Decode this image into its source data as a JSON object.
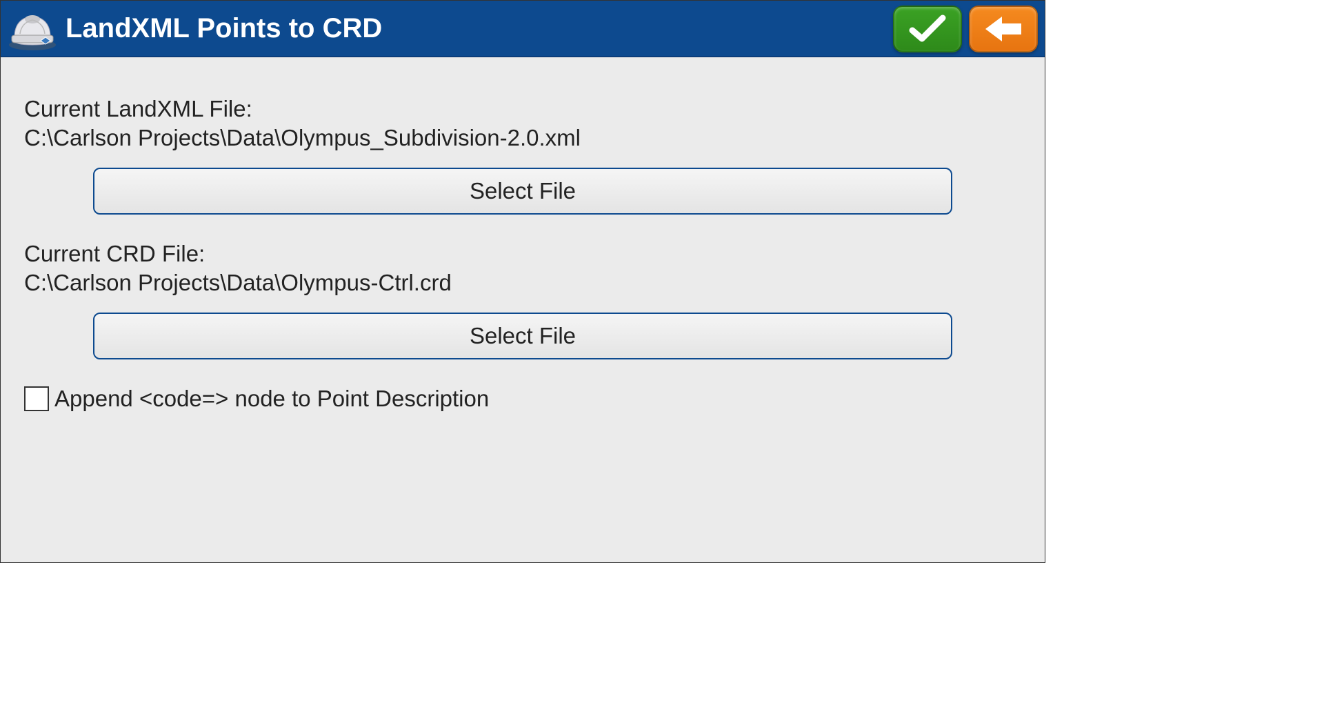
{
  "header": {
    "title": "LandXML Points to CRD"
  },
  "landxml": {
    "label": "Current LandXML File:",
    "path": "C:\\Carlson Projects\\Data\\Olympus_Subdivision-2.0.xml",
    "select_label": "Select File"
  },
  "crd": {
    "label": "Current CRD File:",
    "path": "C:\\Carlson Projects\\Data\\Olympus-Ctrl.crd",
    "select_label": "Select File"
  },
  "append_option": {
    "label": "Append <code=> node to Point Description",
    "checked": false
  }
}
